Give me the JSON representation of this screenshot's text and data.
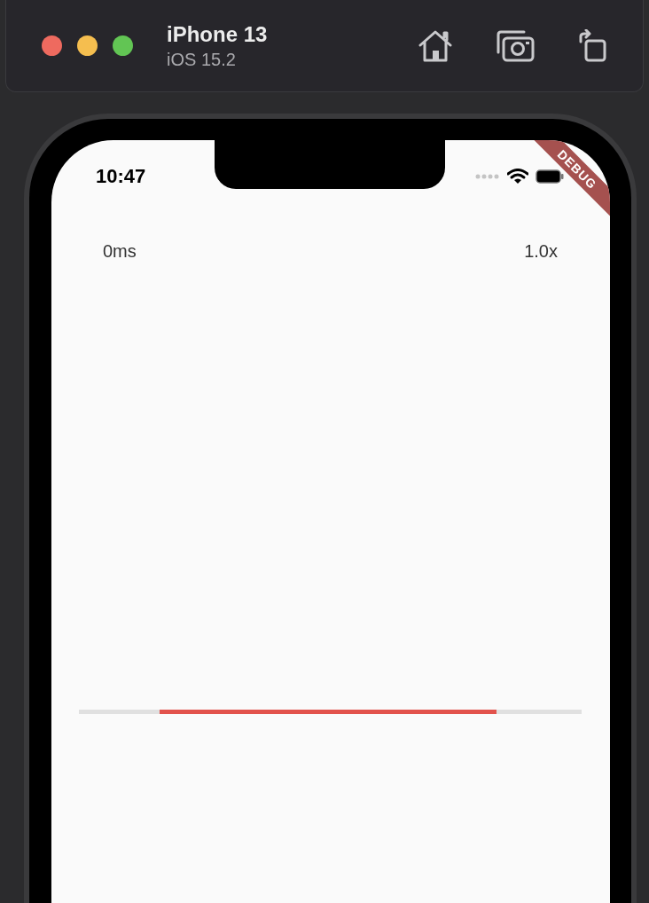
{
  "window": {
    "title": "iPhone 13",
    "subtitle": "iOS 15.2"
  },
  "status_bar": {
    "time": "10:47"
  },
  "debug_banner": {
    "label": "DEBUG"
  },
  "labels": {
    "position": "0ms",
    "speed": "1.0x"
  },
  "progress": {
    "end": {
      "level": 0.83
    },
    "start": {
      "level": 0.16
    }
  }
}
